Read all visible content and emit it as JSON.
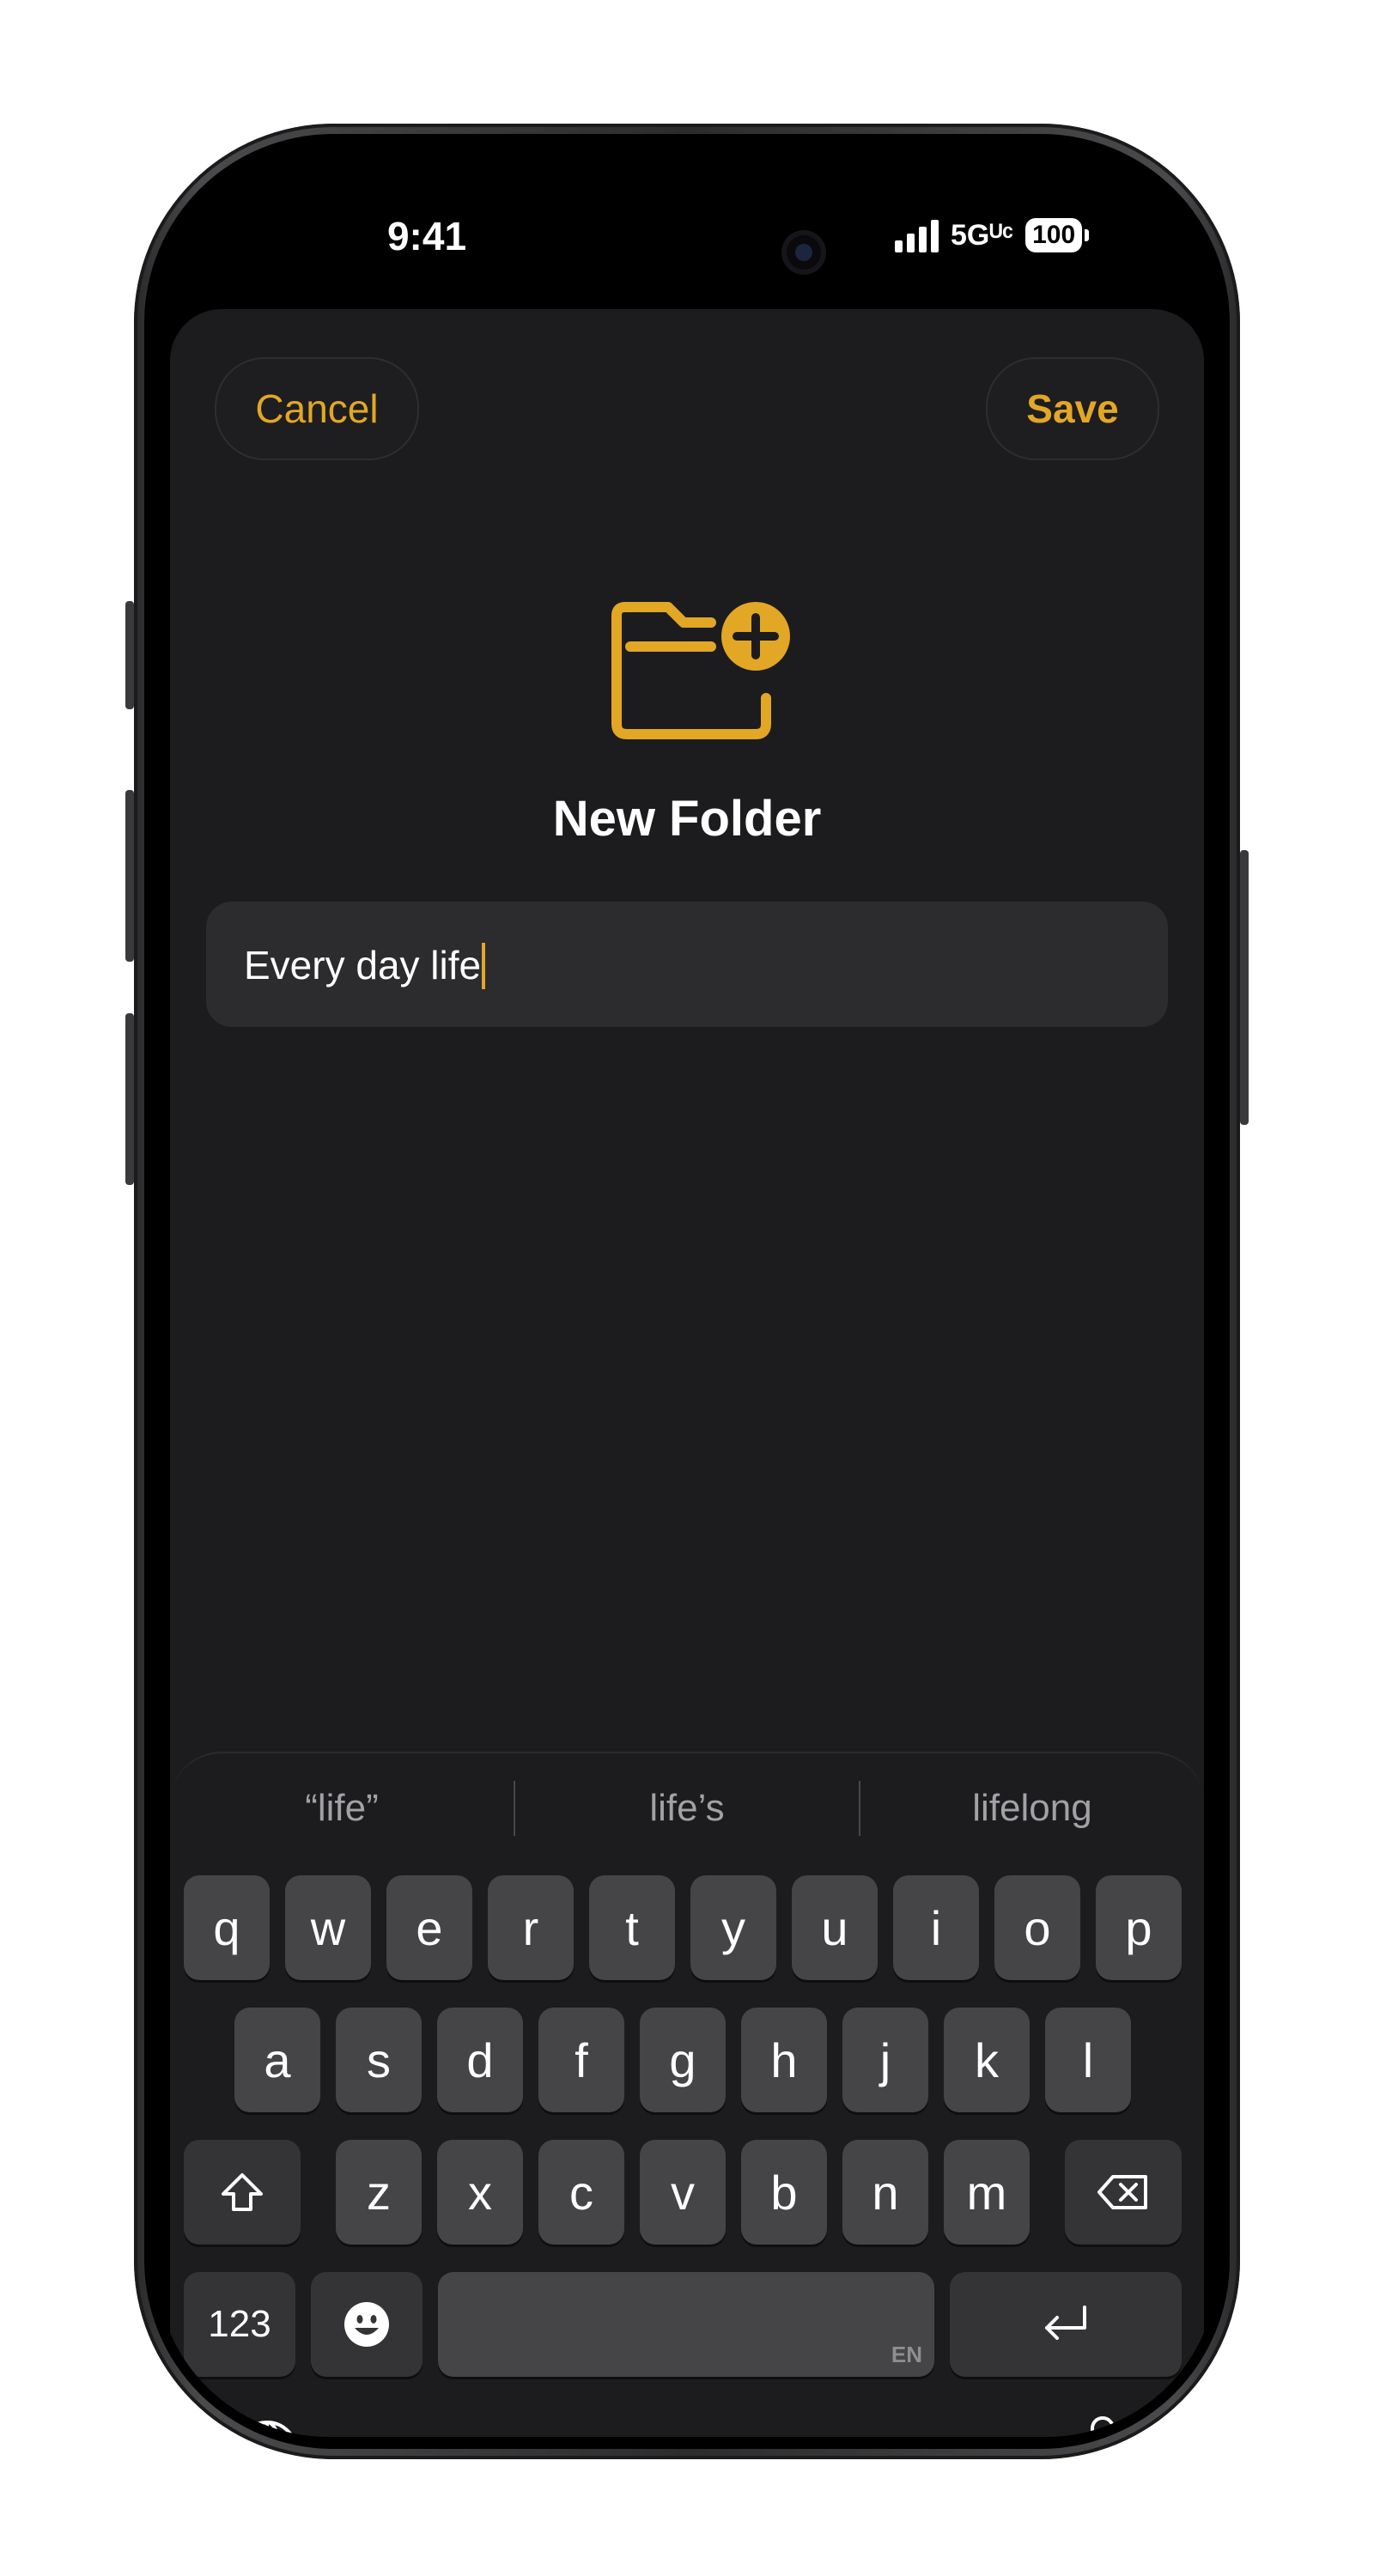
{
  "status_bar": {
    "time": "9:41",
    "network": "5Gᵁᶜ",
    "battery": "100"
  },
  "sheet": {
    "cancel_label": "Cancel",
    "save_label": "Save",
    "title": "New Folder",
    "folder_icon": "folder-badge-plus-icon",
    "name_field_value": "Every day life"
  },
  "keyboard": {
    "suggestions": [
      "“life”",
      "life’s",
      "lifelong"
    ],
    "row1": [
      "q",
      "w",
      "e",
      "r",
      "t",
      "y",
      "u",
      "i",
      "o",
      "p"
    ],
    "row2": [
      "a",
      "s",
      "d",
      "f",
      "g",
      "h",
      "j",
      "k",
      "l"
    ],
    "row3": [
      "z",
      "x",
      "c",
      "v",
      "b",
      "n",
      "m"
    ],
    "numbers_label": "123",
    "space_language": "EN",
    "icons": {
      "shift": "shift-icon",
      "delete": "delete-icon",
      "emoji": "emoji-icon",
      "return": "return-icon",
      "globe": "globe-icon",
      "dictation": "microphone-icon"
    }
  },
  "colors": {
    "accent": "#e3a726",
    "sheet_background": "#1c1c1e",
    "field_background": "#2c2c2e",
    "key_background": "#454547"
  }
}
